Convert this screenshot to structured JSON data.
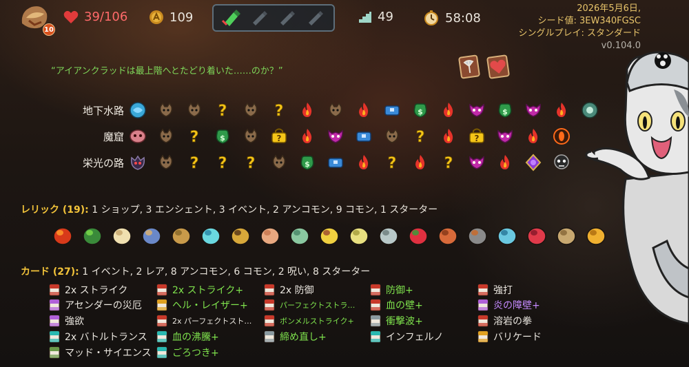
{
  "topbar": {
    "ascension": "10",
    "hp": "39/106",
    "gold": "109",
    "floor": "49",
    "time": "58:08"
  },
  "run_info": {
    "date": "2026年5月6日,",
    "seed": "シード値: 3EW340FGSC",
    "mode": "シングルプレイ: スタンダード",
    "version": "v0.104.0"
  },
  "quote": "“アイアンクラッドは最上階へとたどり着いた……のか？”",
  "acts": [
    {
      "name": "地下水路",
      "nodes": [
        "boss-sea",
        "monster",
        "monster",
        "unknown",
        "monster",
        "unknown",
        "elite",
        "monster",
        "elite",
        "treasure",
        "shop",
        "elite",
        "elite-mask",
        "shop",
        "elite-mask",
        "elite",
        "boss-end"
      ]
    },
    {
      "name": "魔窟",
      "nodes": [
        "boss-flesh",
        "monster",
        "unknown",
        "shop",
        "monster",
        "unknown-lock",
        "elite",
        "elite-mask",
        "treasure",
        "monster",
        "unknown",
        "elite",
        "unknown-lock",
        "elite-mask",
        "elite",
        "boss-eye"
      ]
    },
    {
      "name": "栄光の路",
      "nodes": [
        "boss-dark",
        "monster",
        "unknown",
        "unknown",
        "unknown",
        "monster",
        "shop",
        "treasure",
        "elite",
        "unknown",
        "elite",
        "unknown",
        "elite-mask",
        "elite",
        "relic-purple",
        "boss-skull"
      ]
    }
  ],
  "relics": {
    "title": "レリック (19):",
    "summary": "1 ショップ,  3 エンシェント, 3 イベント, 2 アンコモン, 9 コモン, 1 スターター",
    "items": [
      "burning-blood",
      "herb",
      "cheese",
      "tin",
      "pipe",
      "ice-shard",
      "lantern",
      "bread",
      "teapot",
      "flower-pot",
      "pear",
      "whetstone",
      "strawberry",
      "mask",
      "anvil",
      "bead-bracelet",
      "red-claw",
      "bag",
      "gold-leaf"
    ]
  },
  "cards": {
    "title": "カード (27):",
    "summary": "1 イベント, 2 レア, 8 アンコモン, 6 コモン, 2 呪い, 8 スターター",
    "columns": [
      [
        {
          "label": "2x ストライク",
          "style": "normal",
          "icon": "red"
        },
        {
          "label": "アセンダーの災厄",
          "style": "normal",
          "icon": "purple"
        },
        {
          "label": "強欲",
          "style": "normal",
          "icon": "purple"
        },
        {
          "label": "2x バトルトランス",
          "style": "normal",
          "icon": "teal"
        },
        {
          "label": "マッド・サイエンス",
          "style": "normal",
          "icon": "green"
        }
      ],
      [
        {
          "label": "2x ストライク+",
          "style": "up",
          "icon": "red"
        },
        {
          "label": "ヘル・レイザー+",
          "style": "up",
          "icon": "gold"
        },
        {
          "label": "2x パーフェクトスト…",
          "style": "small",
          "icon": "red"
        },
        {
          "label": "血の沸騰+",
          "style": "up",
          "icon": "teal"
        },
        {
          "label": "ごろつき+",
          "style": "up",
          "icon": "teal"
        }
      ],
      [
        {
          "label": "2x 防御",
          "style": "normal",
          "icon": "red"
        },
        {
          "label": "パーフェクトストラ…",
          "style": "upsmall",
          "icon": "red"
        },
        {
          "label": "ボンメルストライク+",
          "style": "upsmall",
          "icon": "red"
        },
        {
          "label": "締め直し+",
          "style": "up",
          "icon": "grey"
        }
      ],
      [
        {
          "label": "防御+",
          "style": "up",
          "icon": "red"
        },
        {
          "label": "血の壁+",
          "style": "up",
          "icon": "red"
        },
        {
          "label": "衝撃波+",
          "style": "up",
          "icon": "grey"
        },
        {
          "label": "インフェルノ",
          "style": "normal",
          "icon": "teal"
        }
      ],
      [
        {
          "label": "強打",
          "style": "normal",
          "icon": "red"
        },
        {
          "label": "炎の障壁+",
          "style": "rare",
          "icon": "purple"
        },
        {
          "label": "溶岩の拳",
          "style": "normal",
          "icon": "red"
        },
        {
          "label": "バリケード",
          "style": "normal",
          "icon": "gold"
        }
      ]
    ]
  },
  "colors": {
    "accent": "#f2c33a",
    "upgrade": "#7fe34d",
    "hp": "#ff6a6a",
    "quote": "#7fd85a"
  }
}
